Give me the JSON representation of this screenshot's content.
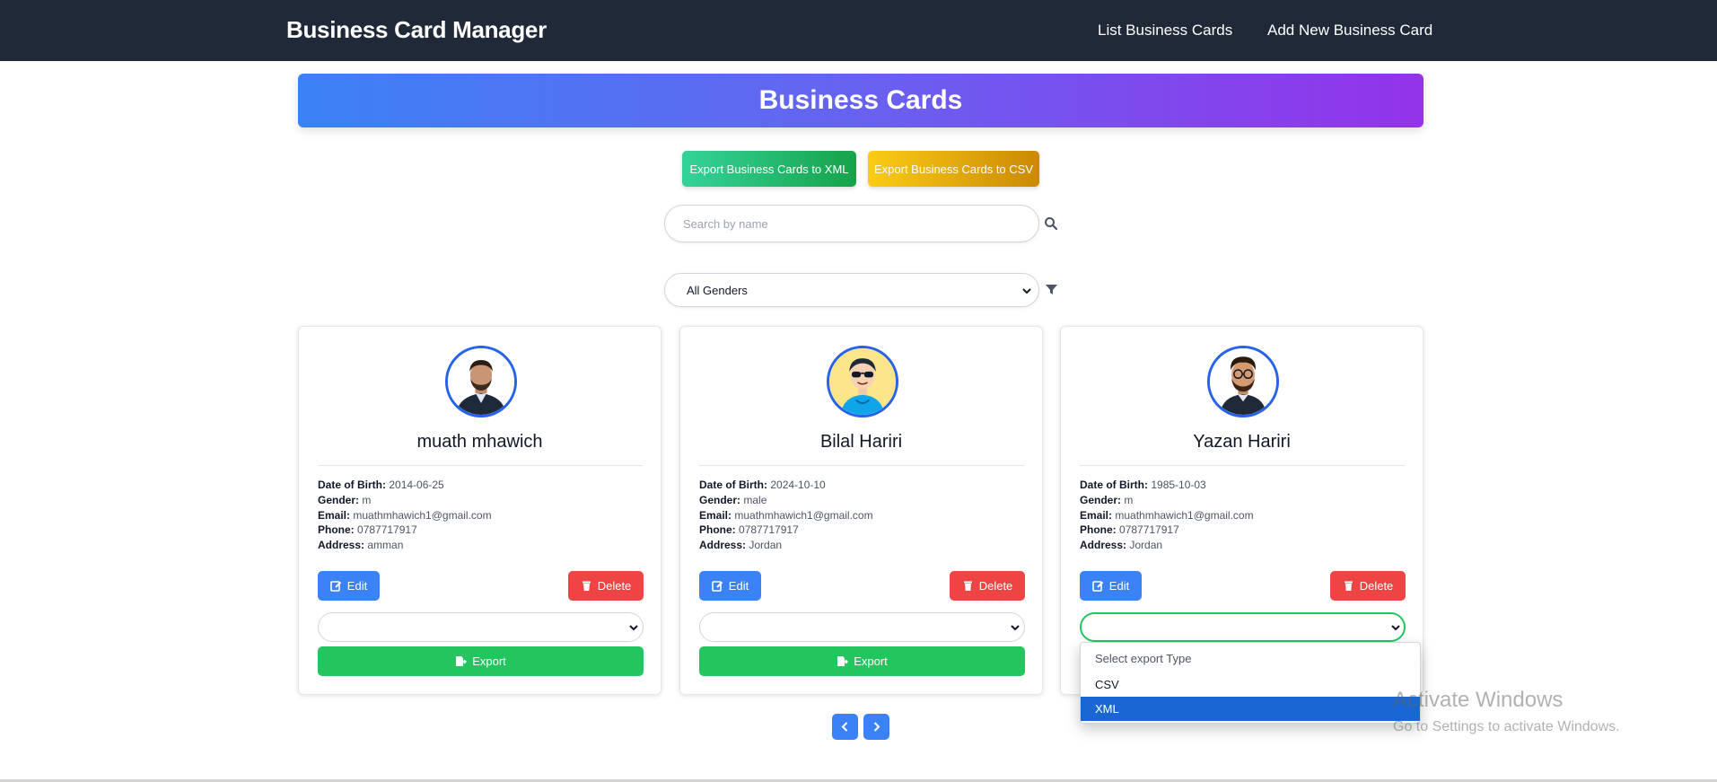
{
  "navbar": {
    "brand": "Business Card Manager",
    "links": [
      "List Business Cards",
      "Add New Business Card"
    ]
  },
  "hero": {
    "title": "Business Cards"
  },
  "actions": {
    "export_xml": "Export Business Cards to XML",
    "export_csv": "Export Business Cards to CSV"
  },
  "search": {
    "placeholder": "Search by name",
    "icon": "search-icon"
  },
  "filter": {
    "selected": "All Genders",
    "icon": "filter-icon"
  },
  "labels": {
    "dob": "Date of Birth:",
    "gender": "Gender:",
    "email": "Email:",
    "phone": "Phone:",
    "address": "Address:",
    "edit": "Edit",
    "delete": "Delete",
    "export": "Export"
  },
  "cards": [
    {
      "name": "muath mhawich",
      "dob": "2014-06-25",
      "gender": "m",
      "email": "muathmhawich1@gmail.com",
      "phone": "0787717917",
      "address": "amman"
    },
    {
      "name": "Bilal Hariri",
      "dob": "2024-10-10",
      "gender": "male",
      "email": "muathmhawich1@gmail.com",
      "phone": "0787717917",
      "address": "Jordan"
    },
    {
      "name": "Yazan Hariri",
      "dob": "1985-10-03",
      "gender": "m",
      "email": "muathmhawich1@gmail.com",
      "phone": "0787717917",
      "address": "Jordan"
    }
  ],
  "export_dropdown": {
    "options": [
      "Select export Type",
      "CSV",
      "XML"
    ],
    "highlighted": "XML"
  },
  "watermark": {
    "title": "Activate Windows",
    "subtitle": "Go to Settings to activate Windows."
  },
  "colors": {
    "navbar": "#1f2937",
    "primary": "#3b82f6",
    "danger": "#ef4444",
    "success": "#22c55e",
    "warning": "#eab308",
    "hero_gradient": [
      "#3b82f6",
      "#9333ea"
    ]
  }
}
